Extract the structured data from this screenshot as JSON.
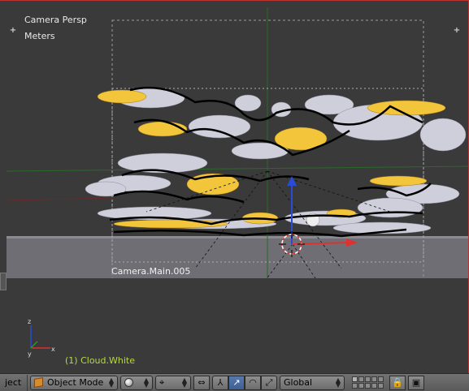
{
  "viewport": {
    "view_name": "Camera Persp",
    "units": "Meters",
    "camera_label": "Camera.Main.005",
    "object_info": "(1) Cloud.White"
  },
  "header": {
    "menu_tail": "ject",
    "mode_label": "Object Mode",
    "orientation_label": "Global",
    "active_tool": "manipulator-translate"
  },
  "colors": {
    "viewport_bg": "#3a3a3a",
    "cloud_white": "#d4d4e0",
    "cloud_yellow": "#f2c53a",
    "axis_x": "#e03030",
    "axis_y": "#2a9a2a",
    "axis_z": "#2a4ad8",
    "object_text": "#b8d84a",
    "active_button": "#5679b0"
  }
}
